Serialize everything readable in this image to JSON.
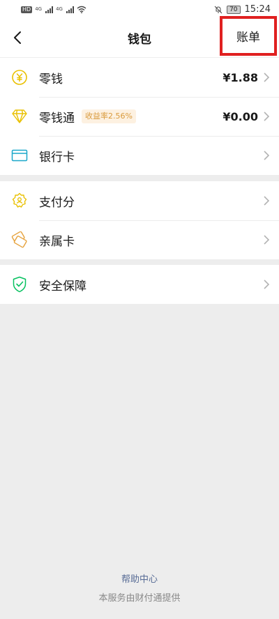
{
  "status_bar": {
    "hd": "HD",
    "net1": "4G",
    "net2": "4G",
    "battery": "70",
    "time": "15:24"
  },
  "nav": {
    "title": "钱包",
    "bill_label": "账单"
  },
  "groups": [
    {
      "items": [
        {
          "label": "零钱",
          "value": "¥1.88",
          "icon": "yuan-coin-icon"
        },
        {
          "label": "零钱通",
          "badge": "收益率2.56%",
          "value": "¥0.00",
          "icon": "diamond-icon"
        },
        {
          "label": "银行卡",
          "icon": "bank-card-icon"
        }
      ]
    },
    {
      "items": [
        {
          "label": "支付分",
          "icon": "pay-score-icon"
        },
        {
          "label": "亲属卡",
          "icon": "family-card-icon"
        }
      ]
    },
    {
      "items": [
        {
          "label": "安全保障",
          "icon": "security-shield-icon"
        }
      ]
    }
  ],
  "footer": {
    "help": "帮助中心",
    "provider": "本服务由财付通提供"
  },
  "colors": {
    "yellow": "#e9c000",
    "teal": "#10aeff",
    "orange": "#e6a23c",
    "green": "#07c160",
    "link": "#576b95",
    "highlight": "#e02020"
  }
}
